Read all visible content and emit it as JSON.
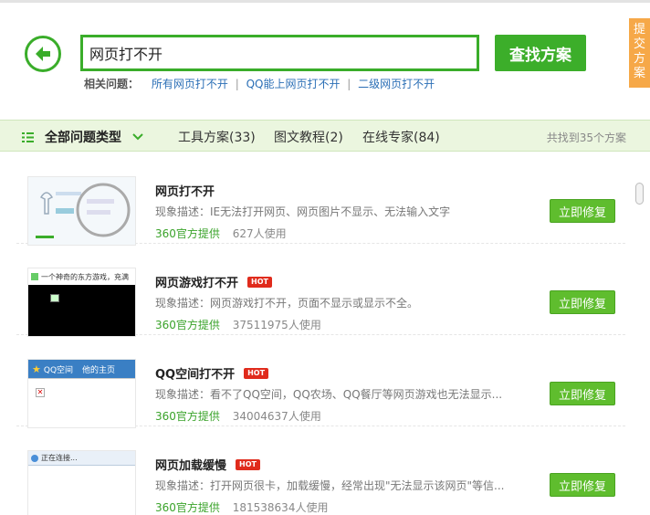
{
  "search": {
    "value": "网页打不开",
    "button_label": "查找方案"
  },
  "submit_tab": {
    "label": "提交方案"
  },
  "related": {
    "label": "相关问题：",
    "links": [
      "所有网页打不开",
      "QQ能上网页打不开",
      "二级网页打不开"
    ],
    "separator": "|"
  },
  "tabs": {
    "all_label": "全部问题类型",
    "tool": "工具方案(33)",
    "tutorial": "图文教程(2)",
    "expert": "在线专家(84)",
    "found": "共找到35个方案"
  },
  "results": [
    {
      "title": "网页打不开",
      "hot": false,
      "desc": "现象描述：IE无法打开网页、网页图片不显示、无法输入文字",
      "source": "360官方提供",
      "uses": "627人使用",
      "button": "立即修复"
    },
    {
      "title": "网页游戏打不开",
      "hot": true,
      "hot_label": "HOT",
      "desc": "现象描述：网页游戏打不开，页面不显示或显示不全。",
      "source": "360官方提供",
      "uses": "37511975人使用",
      "button": "立即修复",
      "thumb_text": "一个神奇的东方游戏，充满"
    },
    {
      "title": "QQ空间打不开",
      "hot": true,
      "hot_label": "HOT",
      "desc": "现象描述：看不了QQ空间，QQ农场、QQ餐厅等网页游戏也无法显示...",
      "source": "360官方提供",
      "uses": "34004637人使用",
      "button": "立即修复",
      "thumb_text": "QQ空间",
      "thumb_text2": "他的主页"
    },
    {
      "title": "网页加载缓慢",
      "hot": true,
      "hot_label": "HOT",
      "desc": "现象描述：打开网页很卡，加载缓慢，经常出现\"无法显示该网页\"等信...",
      "source": "360官方提供",
      "uses": "181538634人使用",
      "button": "立即修复",
      "thumb_text": "正在连接..."
    }
  ],
  "colors": {
    "green": "#3aad2a",
    "orange": "#f6a848",
    "hot": "#e02b1c",
    "tabbar": "#ebf6df"
  }
}
